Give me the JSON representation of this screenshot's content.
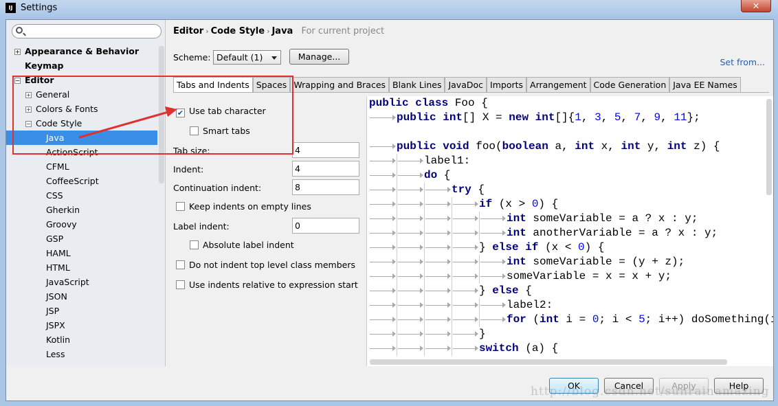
{
  "window": {
    "title": "Settings",
    "app_icon": "IJ",
    "close": "✕"
  },
  "sidebar": {
    "search_placeholder": "",
    "items": [
      {
        "label": "Appearance & Behavior",
        "toggle": "+",
        "level": 0,
        "bold": true
      },
      {
        "label": "Keymap",
        "toggle": "",
        "level": 0,
        "bold": true
      },
      {
        "label": "Editor",
        "toggle": "−",
        "level": 0,
        "bold": true
      },
      {
        "label": "General",
        "toggle": "+",
        "level": 1
      },
      {
        "label": "Colors & Fonts",
        "toggle": "+",
        "level": 1
      },
      {
        "label": "Code Style",
        "toggle": "−",
        "level": 1
      },
      {
        "label": "Java",
        "level": 2,
        "selected": true
      },
      {
        "label": "ActionScript",
        "level": 2
      },
      {
        "label": "CFML",
        "level": 2
      },
      {
        "label": "CoffeeScript",
        "level": 2
      },
      {
        "label": "CSS",
        "level": 2
      },
      {
        "label": "Gherkin",
        "level": 2
      },
      {
        "label": "Groovy",
        "level": 2
      },
      {
        "label": "GSP",
        "level": 2
      },
      {
        "label": "HAML",
        "level": 2
      },
      {
        "label": "HTML",
        "level": 2
      },
      {
        "label": "JavaScript",
        "level": 2
      },
      {
        "label": "JSON",
        "level": 2
      },
      {
        "label": "JSP",
        "level": 2
      },
      {
        "label": "JSPX",
        "level": 2
      },
      {
        "label": "Kotlin",
        "level": 2
      },
      {
        "label": "Less",
        "level": 2
      }
    ]
  },
  "breadcrumb": {
    "items": [
      "Editor",
      "Code Style",
      "Java"
    ],
    "separator": "›",
    "scope": "For current project"
  },
  "scheme": {
    "label": "Scheme:",
    "value": "Default (1)",
    "manage": "Manage...",
    "set_from": "Set from..."
  },
  "tabs": [
    "Tabs and Indents",
    "Spaces",
    "Wrapping and Braces",
    "Blank Lines",
    "JavaDoc",
    "Imports",
    "Arrangement",
    "Code Generation",
    "Java EE Names"
  ],
  "options": {
    "use_tab_character": {
      "label": "Use tab character",
      "checked": true
    },
    "smart_tabs": {
      "label": "Smart tabs",
      "checked": false
    },
    "tab_size": {
      "label": "Tab size:",
      "value": "4"
    },
    "indent": {
      "label": "Indent:",
      "value": "4"
    },
    "continuation_indent": {
      "label": "Continuation indent:",
      "value": "8"
    },
    "keep_indents": {
      "label": "Keep indents on empty lines",
      "checked": false
    },
    "label_indent": {
      "label": "Label indent:",
      "value": "0"
    },
    "absolute_label_indent": {
      "label": "Absolute label indent",
      "checked": false
    },
    "no_indent_top_level": {
      "label": "Do not indent top level class members",
      "checked": false
    },
    "relative_indents": {
      "label": "Use indents relative to expression start",
      "checked": false
    }
  },
  "code": [
    {
      "indent": 0,
      "tokens": [
        [
          "kw",
          "public class"
        ],
        [
          "p",
          " Foo {"
        ]
      ]
    },
    {
      "indent": 1,
      "tokens": [
        [
          "kw",
          "public int"
        ],
        [
          "p",
          "[] X = "
        ],
        [
          "kw",
          "new int"
        ],
        [
          "p",
          "[]{"
        ],
        [
          "num",
          "1"
        ],
        [
          "p",
          ", "
        ],
        [
          "num",
          "3"
        ],
        [
          "p",
          ", "
        ],
        [
          "num",
          "5"
        ],
        [
          "p",
          ", "
        ],
        [
          "num",
          "7"
        ],
        [
          "p",
          ", "
        ],
        [
          "num",
          "9"
        ],
        [
          "p",
          ", "
        ],
        [
          "num",
          "11"
        ],
        [
          "p",
          "};"
        ]
      ]
    },
    {
      "indent": 0,
      "tokens": []
    },
    {
      "indent": 1,
      "tokens": [
        [
          "kw",
          "public void"
        ],
        [
          "p",
          " foo("
        ],
        [
          "kw",
          "boolean"
        ],
        [
          "p",
          " a, "
        ],
        [
          "kw",
          "int"
        ],
        [
          "p",
          " x, "
        ],
        [
          "kw",
          "int"
        ],
        [
          "p",
          " y, "
        ],
        [
          "kw",
          "int"
        ],
        [
          "p",
          " z) {"
        ]
      ]
    },
    {
      "indent": 2,
      "tokens": [
        [
          "p",
          "label1:"
        ]
      ]
    },
    {
      "indent": 2,
      "tokens": [
        [
          "kw",
          "do"
        ],
        [
          "p",
          " {"
        ]
      ]
    },
    {
      "indent": 3,
      "tokens": [
        [
          "kw",
          "try"
        ],
        [
          "p",
          " {"
        ]
      ]
    },
    {
      "indent": 4,
      "tokens": [
        [
          "kw",
          "if"
        ],
        [
          "p",
          " (x > "
        ],
        [
          "num",
          "0"
        ],
        [
          "p",
          ") {"
        ]
      ]
    },
    {
      "indent": 5,
      "tokens": [
        [
          "kw",
          "int"
        ],
        [
          "p",
          " someVariable = a ? x : y;"
        ]
      ]
    },
    {
      "indent": 5,
      "tokens": [
        [
          "kw",
          "int"
        ],
        [
          "p",
          " anotherVariable = a ? x : y;"
        ]
      ]
    },
    {
      "indent": 4,
      "tokens": [
        [
          "p",
          "} "
        ],
        [
          "kw",
          "else if"
        ],
        [
          "p",
          " (x < "
        ],
        [
          "num",
          "0"
        ],
        [
          "p",
          ") {"
        ]
      ]
    },
    {
      "indent": 5,
      "tokens": [
        [
          "kw",
          "int"
        ],
        [
          "p",
          " someVariable = (y + z);"
        ]
      ]
    },
    {
      "indent": 5,
      "tokens": [
        [
          "p",
          "someVariable = x = x + y;"
        ]
      ]
    },
    {
      "indent": 4,
      "tokens": [
        [
          "p",
          "} "
        ],
        [
          "kw",
          "else"
        ],
        [
          "p",
          " {"
        ]
      ]
    },
    {
      "indent": 5,
      "tokens": [
        [
          "p",
          "label2:"
        ]
      ]
    },
    {
      "indent": 5,
      "tokens": [
        [
          "kw",
          "for"
        ],
        [
          "p",
          " ("
        ],
        [
          "kw",
          "int"
        ],
        [
          "p",
          " i = "
        ],
        [
          "num",
          "0"
        ],
        [
          "p",
          "; i < "
        ],
        [
          "num",
          "5"
        ],
        [
          "p",
          "; i++) doSomething(i);"
        ]
      ]
    },
    {
      "indent": 4,
      "tokens": [
        [
          "p",
          "}"
        ]
      ]
    },
    {
      "indent": 4,
      "tokens": [
        [
          "kw",
          "switch"
        ],
        [
          "p",
          " (a) {"
        ]
      ]
    }
  ],
  "footer": {
    "ok": "OK",
    "cancel": "Cancel",
    "apply": "Apply",
    "help": "Help"
  },
  "watermark": "http://blog.csdn.net/sunrainamazing",
  "colors": {
    "keyword": "#000080",
    "number": "#0000ff",
    "selection": "#3a8ee6",
    "annotation": "#e03030"
  }
}
